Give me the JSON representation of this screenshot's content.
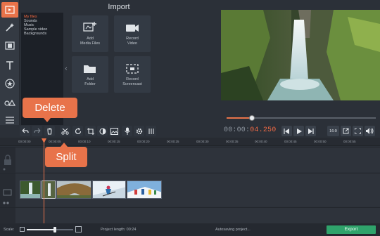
{
  "import": {
    "title": "Import",
    "tiles": [
      {
        "label": "Add\nMedia Files",
        "icon": "add-media-icon"
      },
      {
        "label": "Record\nVideo",
        "icon": "camera-icon"
      },
      {
        "label": "Add\nFolder",
        "icon": "folder-icon"
      },
      {
        "label": "Record\nScreencast",
        "icon": "screencast-icon"
      }
    ]
  },
  "file_list": [
    "My files",
    "Sounds",
    "Music",
    "Sample video",
    "Backgrounds"
  ],
  "timecode": {
    "dim": "00:00:",
    "accent": "04.250"
  },
  "aspect": "16:9",
  "ruler_ticks": [
    "00:00:00",
    "00:00:05",
    "00:00:10",
    "00:00:15",
    "00:00:20",
    "00:00:25",
    "00:00:30",
    "00:00:35",
    "00:00:40",
    "00:00:45",
    "00:00:50",
    "00:00:55"
  ],
  "callouts": {
    "delete": "Delete",
    "split": "Split"
  },
  "status": {
    "scale_label": "Scale:",
    "project_length": "Project length:  00:24",
    "autosave": "Autosaving project...",
    "export": "Export"
  },
  "playback_progress": 0.17,
  "colors": {
    "accent": "#e8734a",
    "export": "#2fa36b"
  }
}
